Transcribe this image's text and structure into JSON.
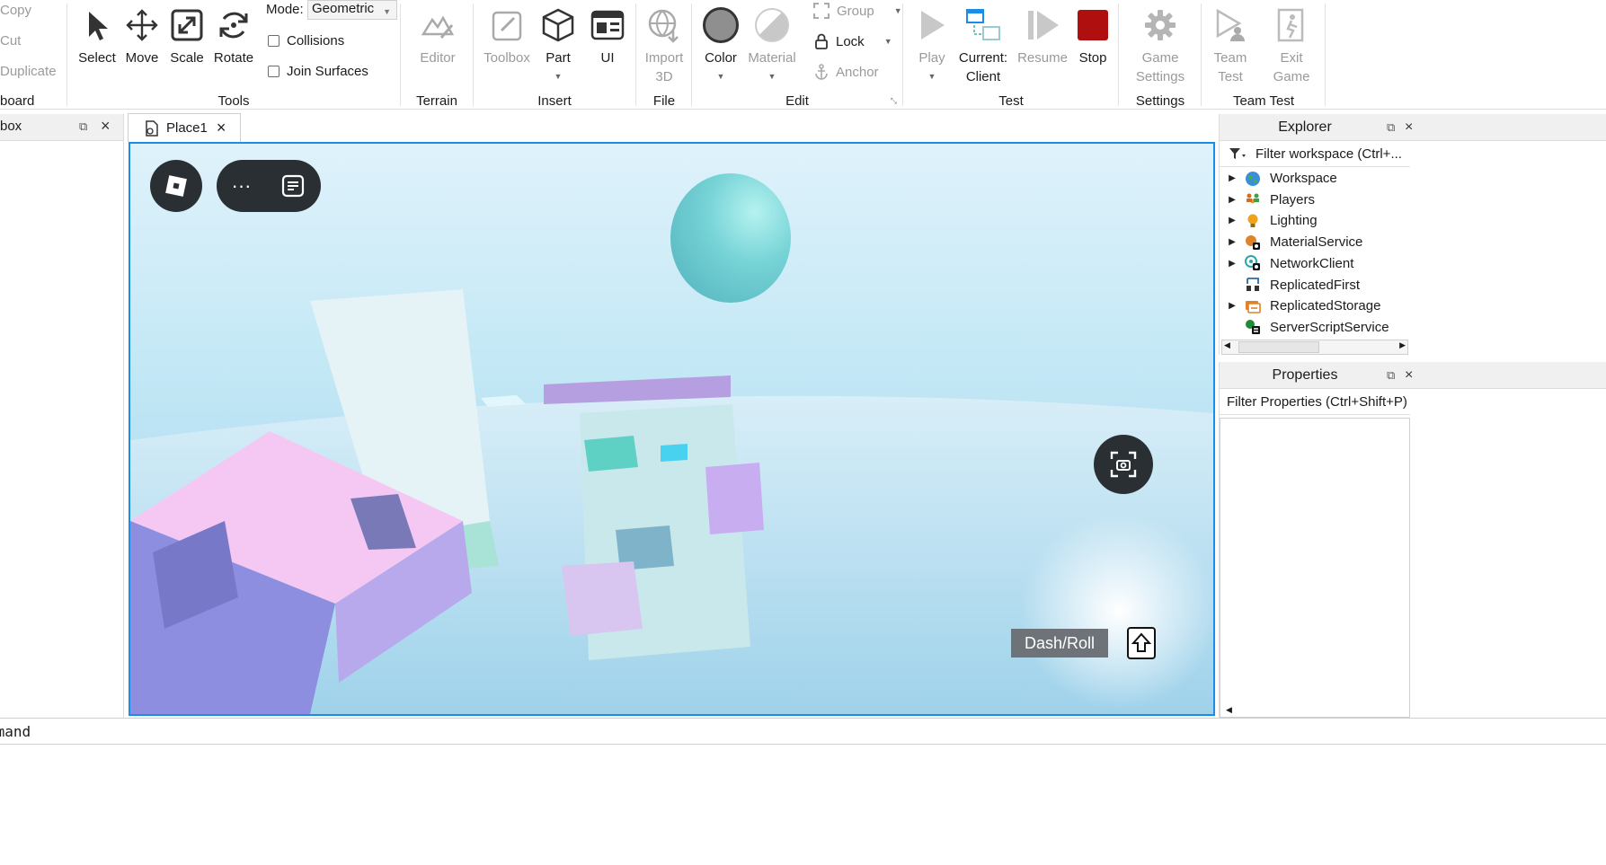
{
  "clipboard": {
    "copy": "Copy",
    "cut": "Cut",
    "duplicate": "Duplicate",
    "group_label": "board"
  },
  "tools": {
    "select": "Select",
    "move": "Move",
    "scale": "Scale",
    "rotate": "Rotate",
    "mode_label": "Mode:",
    "mode_value": "Geometric",
    "collisions": "Collisions",
    "join_surfaces": "Join Surfaces",
    "group_label": "Tools"
  },
  "terrain": {
    "editor": "Editor",
    "group_label": "Terrain"
  },
  "insert": {
    "toolbox": "Toolbox",
    "part": "Part",
    "ui": "UI",
    "group_label": "Insert"
  },
  "file": {
    "import_line1": "Import",
    "import_line2": "3D",
    "group_label": "File"
  },
  "edit": {
    "color": "Color",
    "material": "Material",
    "group": "Group",
    "lock": "Lock",
    "anchor": "Anchor",
    "group_label": "Edit",
    "color_value": "#8f8f8f",
    "material_value": "#c8c8c8"
  },
  "test": {
    "play": "Play",
    "current_line1": "Current:",
    "current_line2": "Client",
    "resume": "Resume",
    "stop": "Stop",
    "group_label": "Test",
    "stop_color": "#b00f0f"
  },
  "settings": {
    "game_line1": "Game",
    "game_line2": "Settings",
    "group_label": "Settings"
  },
  "team_test": {
    "team_line1": "Team",
    "team_line2": "Test",
    "exit_line1": "Exit",
    "exit_line2": "Game",
    "group_label": "Team Test"
  },
  "toolbox_panel": {
    "title": "box",
    "close": "×"
  },
  "tabs": {
    "place_label": "Place1",
    "close": "×"
  },
  "viewport": {
    "dash_label": "Dash/Roll",
    "accent": "#1a8ee6"
  },
  "explorer": {
    "title": "Explorer",
    "filter": "Filter workspace (Ctrl+...",
    "items": [
      {
        "label": "Workspace",
        "icon": "globe-icon",
        "expandable": true
      },
      {
        "label": "Players",
        "icon": "players-icon",
        "expandable": true
      },
      {
        "label": "Lighting",
        "icon": "bulb-icon",
        "expandable": true
      },
      {
        "label": "MaterialService",
        "icon": "material-service-icon",
        "expandable": true
      },
      {
        "label": "NetworkClient",
        "icon": "network-icon",
        "expandable": true
      },
      {
        "label": "ReplicatedFirst",
        "icon": "replicated-first-icon",
        "expandable": false
      },
      {
        "label": "ReplicatedStorage",
        "icon": "replicated-storage-icon",
        "expandable": true
      },
      {
        "label": "ServerScriptService",
        "icon": "script-service-icon",
        "expandable": false
      }
    ]
  },
  "properties": {
    "title": "Properties",
    "filter": "Filter Properties (Ctrl+Shift+P)"
  },
  "command": {
    "label": "mmand"
  }
}
